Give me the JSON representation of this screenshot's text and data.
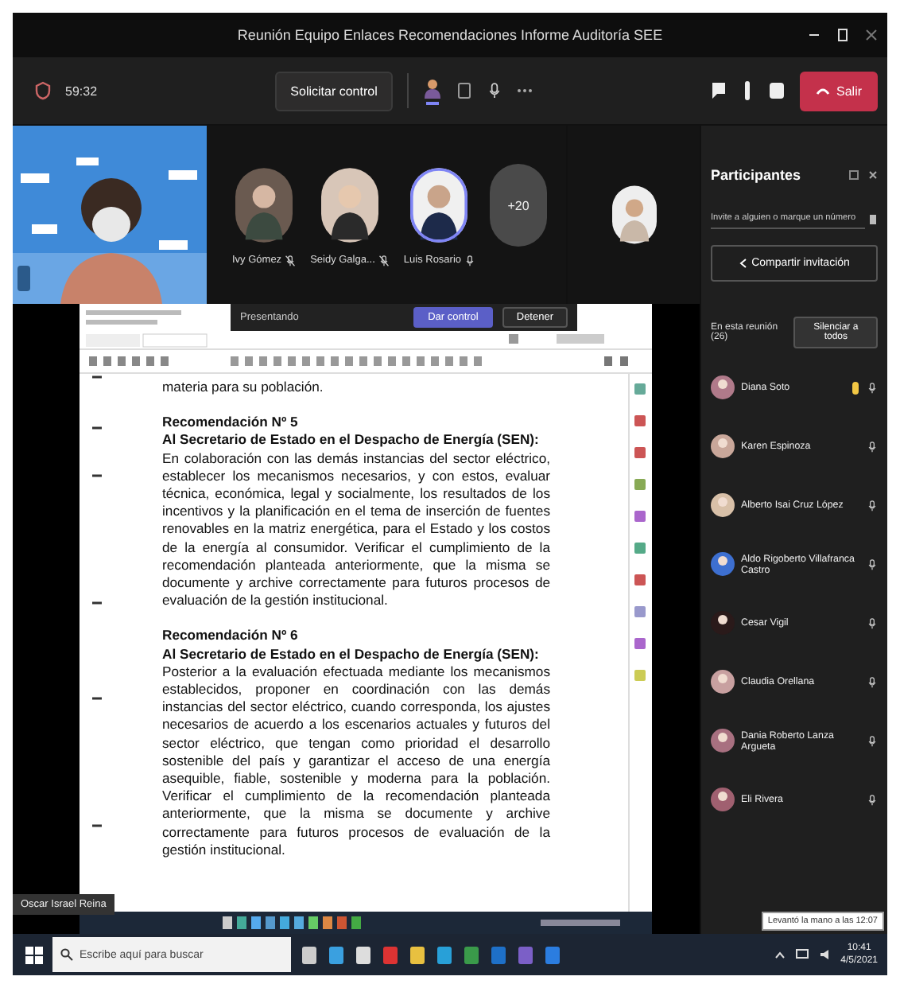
{
  "window": {
    "title": "Reunión Equipo Enlaces Recomendaciones Informe Auditoría SEE"
  },
  "toolbar": {
    "timer": "59:32",
    "request_control": "Solicitar control",
    "leave": "Salir"
  },
  "gallery": {
    "participants": [
      {
        "name": "Ivy Gómez",
        "muted": true
      },
      {
        "name": "Seidy Galga...",
        "muted": true
      },
      {
        "name": "Luis Rosario",
        "muted": false
      }
    ],
    "overflow": "+20"
  },
  "presenter_bar": {
    "label": "Presentando",
    "give_control": "Dar control",
    "stop": "Detener"
  },
  "document": {
    "paragraphs": [
      {
        "kind": "body",
        "text": "materia para su población."
      },
      {
        "kind": "heading",
        "text": "Recomendación Nº 5"
      },
      {
        "kind": "heading",
        "text": "Al Secretario de Estado en el Despacho de Energía (SEN):"
      },
      {
        "kind": "body",
        "text": "En colaboración con las demás instancias del sector eléctrico, establecer los mecanismos necesarios, y con estos, evaluar técnica, económica, legal y socialmente, los resultados de los incentivos y la planificación en el tema de inserción de fuentes renovables en la matriz energética, para el Estado y los costos de la energía al consumidor. Verificar el cumplimiento de la recomendación planteada anteriormente, que la misma se documente y archive correctamente para futuros procesos de evaluación de la gestión institucional."
      },
      {
        "kind": "heading",
        "text": "Recomendación Nº 6"
      },
      {
        "kind": "heading",
        "text": "Al Secretario de Estado en el Despacho de Energía (SEN):"
      },
      {
        "kind": "body",
        "text": "Posterior a la evaluación efectuada mediante los mecanismos establecidos, proponer en coordinación con las demás instancias del sector eléctrico, cuando corresponda, los ajustes necesarios de acuerdo a los escenarios actuales y futuros del sector eléctrico, que tengan como prioridad el desarrollo sostenible del país y garantizar el acceso de una energía asequible, fiable, sostenible y moderna para la población. Verificar el cumplimiento de la recomendación planteada anteriormente, que la misma se documente y archive correctamente para futuros procesos de evaluación de la gestión institucional."
      }
    ]
  },
  "presenter_name": "Oscar Israel Reina",
  "panel": {
    "title": "Participantes",
    "search": {
      "placeholder": "Invite a alguien o marque un número"
    },
    "share": "Compartir invitación",
    "section": "En esta reunión (26)",
    "mute_all": "Silenciar a todos",
    "people": [
      {
        "name": "Diana Soto",
        "hand_raised": true,
        "color": "#b07a8a"
      },
      {
        "name": "Karen Espinoza",
        "hand_raised": false,
        "color": "#c9a79a"
      },
      {
        "name": "Alberto Isai Cruz López",
        "hand_raised": false,
        "color": "#d8c0a8"
      },
      {
        "name": "Aldo Rigoberto Villafranca Castro",
        "hand_raised": false,
        "color": "#3d6fd0"
      },
      {
        "name": "Cesar Vigil",
        "hand_raised": false,
        "color": "#2a1a1a"
      },
      {
        "name": "Claudia Orellana",
        "hand_raised": false,
        "color": "#c8a0a0"
      },
      {
        "name": "Dania Roberto Lanza Argueta",
        "hand_raised": false,
        "color": "#a87080"
      },
      {
        "name": "Eli Rivera",
        "hand_raised": false,
        "color": "#a06070"
      }
    ]
  },
  "tooltip": "Levantó la mano a las 12:07",
  "taskbar": {
    "search": {
      "placeholder": "Escribe aquí para buscar"
    },
    "time": "10:41",
    "date": "4/5/2021"
  }
}
